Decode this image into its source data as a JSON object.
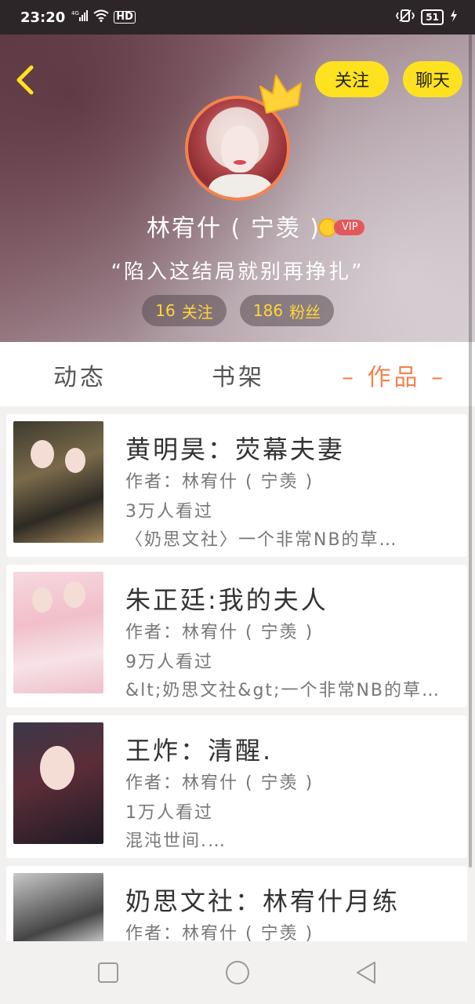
{
  "status_bar": {
    "time": "23:20",
    "network": "4G",
    "hd": "HD",
    "battery": "51"
  },
  "header": {
    "follow_label": "关注",
    "chat_label": "聊天",
    "username": "林宥什 ( 宁羡 )",
    "vip_label": "VIP",
    "bio": "“陷入这结局就别再挣扎”",
    "following_count": "16",
    "following_label": "关注",
    "fans_count": "186",
    "fans_label": "粉丝"
  },
  "tabs": {
    "dynamic": "动态",
    "shelf": "书架",
    "works": "– 作品 –"
  },
  "books": [
    {
      "title": "黄明昊：荧幕夫妻",
      "author": "作者：林宥什 ( 宁羡 )",
      "views": "3万人看过",
      "desc": "〈奶思文社〉一个非常NB的草…"
    },
    {
      "title": "朱正廷:我的夫人",
      "author": "作者：林宥什 ( 宁羡 )",
      "views": "9万人看过",
      "desc": "&lt;奶思文社&gt;一个非常NB的草…"
    },
    {
      "title": "王炸：清醒.",
      "author": "作者：林宥什 ( 宁羡 )",
      "views": "1万人看过",
      "desc": "混沌世间.…"
    },
    {
      "title": "奶思文社：林宥什月练",
      "author": "作者：林宥什 ( 宁羡 )",
      "views": "",
      "desc": ""
    }
  ],
  "colors": {
    "accent": "#f4824e",
    "button_yellow": "#ffe21f",
    "stat_yellow": "#ffd63a"
  }
}
